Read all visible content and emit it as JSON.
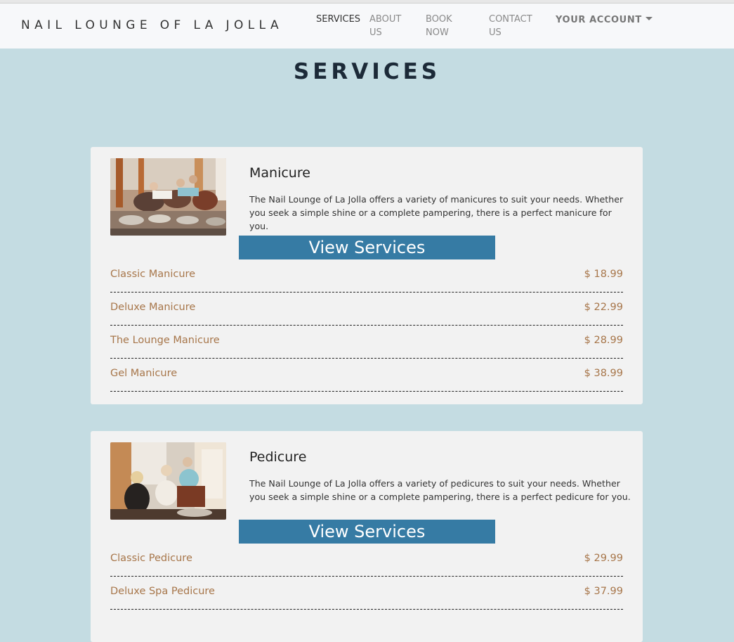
{
  "brand": "NAIL LOUNGE OF LA JOLLA",
  "nav": {
    "services": "SERVICES",
    "about": "ABOUT US",
    "book": "BOOK NOW",
    "contact": "CONTACT US",
    "account": "YOUR ACCOUNT"
  },
  "page_title": "SERVICES",
  "colors": {
    "page_bg": "#c4dce2",
    "button_bg": "#367ba4",
    "price_text": "#a7764a"
  },
  "manicure": {
    "title": "Manicure",
    "description": "The Nail Lounge of La Jolla offers a variety of manicures to suit your needs. Whether you seek a simple shine or a complete pampering, there is a perfect manicure for you.",
    "button": "View Services",
    "items": [
      {
        "name": "Classic Manicure",
        "price": "$ 18.99"
      },
      {
        "name": "Deluxe Manicure",
        "price": "$ 22.99"
      },
      {
        "name": "The Lounge Manicure",
        "price": "$ 28.99"
      },
      {
        "name": "Gel Manicure",
        "price": "$ 38.99"
      }
    ]
  },
  "pedicure": {
    "title": "Pedicure",
    "description": "The Nail Lounge of La Jolla offers a variety of pedicures to suit your needs. Whether you seek a simple shine or a complete pampering, there is a perfect pedicure for you.",
    "button": "View Services",
    "items": [
      {
        "name": "Classic Pedicure",
        "price": "$ 29.99"
      },
      {
        "name": "Deluxe Spa Pedicure",
        "price": "$ 37.99"
      }
    ]
  }
}
